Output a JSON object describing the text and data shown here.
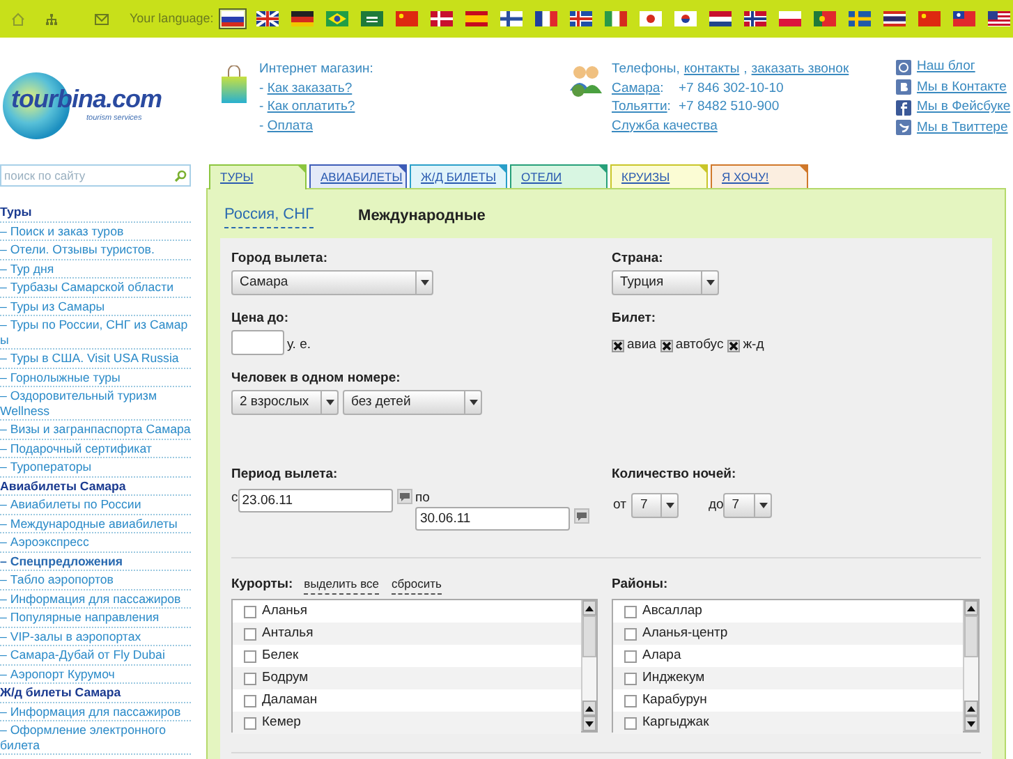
{
  "top_bar": {
    "language_label": "Your language:",
    "flags": [
      {
        "kind": "ru",
        "selected": true
      },
      {
        "kind": "gb",
        "selected": false
      },
      {
        "kind": "de",
        "selected": false
      },
      {
        "kind": "br",
        "selected": false
      },
      {
        "kind": "sa",
        "selected": false
      },
      {
        "kind": "cn",
        "selected": false
      },
      {
        "kind": "dk",
        "selected": false
      },
      {
        "kind": "es",
        "selected": false
      },
      {
        "kind": "fi",
        "selected": false
      },
      {
        "kind": "fr",
        "selected": false
      },
      {
        "kind": "is",
        "selected": false
      },
      {
        "kind": "it",
        "selected": false
      },
      {
        "kind": "jp",
        "selected": false
      },
      {
        "kind": "kr",
        "selected": false
      },
      {
        "kind": "nl",
        "selected": false
      },
      {
        "kind": "no",
        "selected": false
      },
      {
        "kind": "pl",
        "selected": false
      },
      {
        "kind": "pt",
        "selected": false
      },
      {
        "kind": "se",
        "selected": false
      },
      {
        "kind": "th",
        "selected": false
      },
      {
        "kind": "cn",
        "selected": false
      },
      {
        "kind": "tw",
        "selected": false
      },
      {
        "kind": "us",
        "selected": false
      }
    ]
  },
  "logo": {
    "name": "tourbina.com",
    "tagline": "tourism services"
  },
  "shop": {
    "title": "Интернет магазин:",
    "links": [
      {
        "prefix": "- ",
        "label": "Как заказать?"
      },
      {
        "prefix": "- ",
        "label": "Как оплатить?"
      },
      {
        "prefix": "- ",
        "label": "Оплата"
      }
    ]
  },
  "contacts": {
    "heading": [
      {
        "text": "Телефоны,",
        "link": false
      },
      {
        "text": "контакты",
        "link": true
      },
      {
        "text": ",",
        "link": false
      },
      {
        "text": "заказать звонок",
        "link": true
      }
    ],
    "phones": [
      {
        "city": "Самара",
        "sep": ":",
        "number": "+7 846 302-10-10"
      },
      {
        "city": "Тольятти",
        "sep": ":",
        "number": "+7 8482 510-900"
      }
    ],
    "quality": "Служба качества"
  },
  "social": [
    {
      "kind": "blog",
      "label": "Наш блог"
    },
    {
      "kind": "vk",
      "label": "Мы в Контакте"
    },
    {
      "kind": "facebook",
      "label": "Мы в Фейсбуке"
    },
    {
      "kind": "twitter",
      "label": "Мы в Твиттере"
    }
  ],
  "sidebar": {
    "search": {
      "placeholder": "поиск по сайту"
    },
    "items": [
      {
        "kind": "heading",
        "text": "Туры"
      },
      {
        "kind": "link",
        "text": "– Поиск и заказ туров"
      },
      {
        "kind": "link",
        "text": "– Отели. Отзывы туристов."
      },
      {
        "kind": "link",
        "text": "– Тур дня"
      },
      {
        "kind": "link",
        "text": "– Турбазы Самарской области"
      },
      {
        "kind": "link",
        "text": "– Туры из Самары"
      },
      {
        "kind": "link",
        "text": "– Туры по России, СНГ из Самар ы"
      },
      {
        "kind": "link",
        "text": "– Туры в США. Visit USA Russia"
      },
      {
        "kind": "link",
        "text": "– Горнолыжные туры"
      },
      {
        "kind": "link",
        "text": "– Оздоровительный туризм Wellness"
      },
      {
        "kind": "link",
        "text": "– Визы и загранпаспорта Самара"
      },
      {
        "kind": "link",
        "text": "– Подарочный сертификат"
      },
      {
        "kind": "link",
        "text": "– Туроператоры"
      },
      {
        "kind": "heading",
        "text": "Авиабилеты Самара"
      },
      {
        "kind": "link",
        "text": "– Авиабилеты по России"
      },
      {
        "kind": "link",
        "text": "– Международные авиабилеты"
      },
      {
        "kind": "link",
        "text": "– Аэроэкспресс"
      },
      {
        "kind": "bold",
        "text": "– Спецпредложения"
      },
      {
        "kind": "link",
        "text": "– Табло аэропортов"
      },
      {
        "kind": "link",
        "text": "– Информация для пассажиров"
      },
      {
        "kind": "link",
        "text": "– Популярные направления"
      },
      {
        "kind": "link",
        "text": "– VIP-залы в аэропортах"
      },
      {
        "kind": "link",
        "text": "– Самара-Дубай от Fly Dubai"
      },
      {
        "kind": "link",
        "text": "– Аэропорт Курумоч"
      },
      {
        "kind": "heading",
        "text": "Ж/д билеты Самара"
      },
      {
        "kind": "link",
        "text": "– Информация для пассажиров"
      },
      {
        "kind": "link",
        "text": "– Оформление электронного билета"
      }
    ]
  },
  "tabs": [
    {
      "label": "ТУРЫ",
      "selected": true,
      "color": "#8cc63f"
    },
    {
      "label": "АВИАБИЛЕТЫ",
      "selected": false,
      "color": "#3d5cb8"
    },
    {
      "label": "Ж/Д БИЛЕТЫ",
      "selected": false,
      "color": "#2a9fc9"
    },
    {
      "label": "ОТЕЛИ",
      "selected": false,
      "color": "#27a07a"
    },
    {
      "label": "КРУИЗЫ",
      "selected": false,
      "color": "#c9c62a"
    },
    {
      "label": "Я ХОЧУ!",
      "selected": false,
      "color": "#d0782a"
    }
  ],
  "subtabs": [
    {
      "label": "Россия, СНГ",
      "selected": false
    },
    {
      "label": "Международные",
      "selected": true
    }
  ],
  "form": {
    "departure_city": {
      "label": "Город вылета:",
      "value": "Самара"
    },
    "country": {
      "label": "Страна:",
      "value": "Турция"
    },
    "price": {
      "label": "Цена до:",
      "unit": "у. е."
    },
    "ticket": {
      "label": "Билет:",
      "options": [
        {
          "label": "авиа",
          "checked": true
        },
        {
          "label": "автобус",
          "checked": true
        },
        {
          "label": "ж-д",
          "checked": true
        }
      ]
    },
    "guests": {
      "label": "Человек в одном номере:",
      "adults": "2 взрослых",
      "children": "без детей"
    },
    "period": {
      "label": "Период вылета:",
      "from_label": "с",
      "from": "23.06.11",
      "to_label": "по",
      "to": "30.06.11"
    },
    "nights": {
      "label": "Количество ночей:",
      "from_label": "от",
      "from": "7",
      "to_label": "до",
      "to": "7"
    },
    "resorts": {
      "label": "Курорты:",
      "select_all": "выделить все",
      "reset": "сбросить",
      "items": [
        {
          "label": "Аланья",
          "checked": false
        },
        {
          "label": "Анталья",
          "checked": false
        },
        {
          "label": "Белек",
          "checked": false
        },
        {
          "label": "Бодрум",
          "checked": false
        },
        {
          "label": "Даламан",
          "checked": false
        },
        {
          "label": "Кемер",
          "checked": false
        }
      ]
    },
    "districts": {
      "label": "Районы:",
      "items": [
        {
          "label": "Авсаллар",
          "checked": false
        },
        {
          "label": "Аланья-центр",
          "checked": false
        },
        {
          "label": "Алара",
          "checked": false
        },
        {
          "label": "Инджекум",
          "checked": false
        },
        {
          "label": "Карабурун",
          "checked": false
        },
        {
          "label": "Каргыджак",
          "checked": false
        }
      ]
    }
  }
}
